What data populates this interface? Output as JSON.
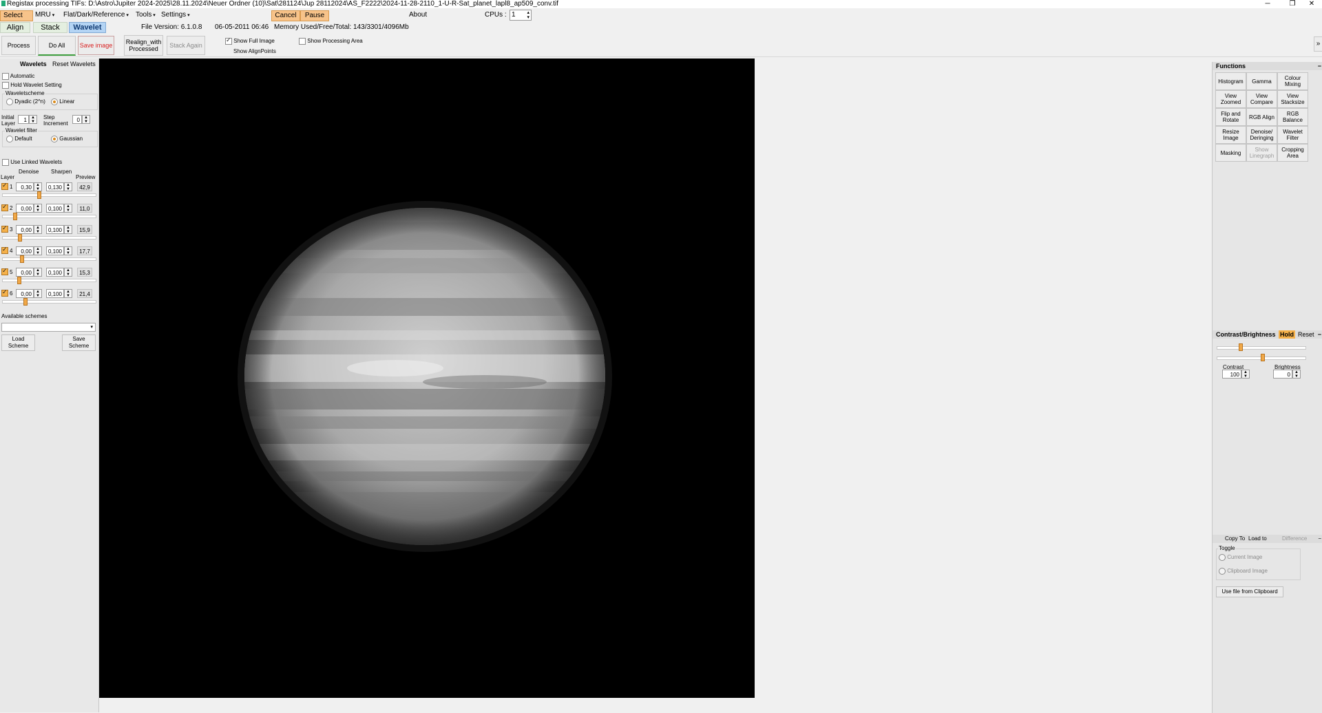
{
  "window": {
    "title": "Registax processing TIFs: D:\\Astro\\Jupiter 2024-2025\\28.11.2024\\Neuer Ordner (10)\\Sat\\281124\\Jup 28112024\\AS_F2222\\2024-11-28-2110_1-U-R-Sat_planet_lapl8_ap509_conv.tif",
    "minimize": "─",
    "maximize": "❐",
    "close": "✕"
  },
  "menu": {
    "select": "Select",
    "mru": "MRU",
    "flat": "Flat/Dark/Reference",
    "tools": "Tools",
    "settings": "Settings",
    "cancel": "Cancel",
    "pause": "Pause",
    "about": "About",
    "cpus_label": "CPUs :",
    "cpus_value": "1"
  },
  "tabs": {
    "align": "Align",
    "stack": "Stack",
    "wavelet": "Wavelet",
    "file_version": "File Version: 6.1.0.8",
    "date": "06-05-2011 06:46",
    "memory": "Memory Used/Free/Total: 143/3301/4096Mb"
  },
  "toolbar": {
    "process": "Process",
    "do_all": "Do All",
    "save_image": "Save image",
    "realign": "Realign_with Processed",
    "stack_again": "Stack Again",
    "show_full_image": "Show Full Image",
    "show_processing_area": "Show Processing Area",
    "show_alignpoints": "Show AlignPoints",
    "expand": "»"
  },
  "left": {
    "wavelets": "Wavelets",
    "reset_wavelets": "Reset Wavelets",
    "automatic": "Automatic",
    "hold_wavelet_setting": "Hold Wavelet Setting",
    "waveletscheme": "Waveletscheme",
    "dyadic": "Dyadic (2^n)",
    "linear": "Linear",
    "initial_layer_label": "Initial Layer",
    "initial_layer_value": "1",
    "step_increment_label": "Step Increment",
    "step_increment_value": "0",
    "wavelet_filter": "Wavelet filter",
    "default": "Default",
    "gaussian": "Gaussian",
    "use_linked_wavelets": "Use Linked Wavelets",
    "col_layer": "Layer",
    "col_denoise": "Denoise",
    "col_sharpen": "Sharpen",
    "col_preview": "Preview",
    "layers": [
      {
        "n": "1",
        "denoise": "0,30",
        "sharpen": "0,130",
        "preview": "42,9",
        "level": 0.38
      },
      {
        "n": "2",
        "denoise": "0,00",
        "sharpen": "0,100",
        "preview": "11,0",
        "level": 0.12
      },
      {
        "n": "3",
        "denoise": "0,00",
        "sharpen": "0,100",
        "preview": "15,9",
        "level": 0.17
      },
      {
        "n": "4",
        "denoise": "0,00",
        "sharpen": "0,100",
        "preview": "17,7",
        "level": 0.19
      },
      {
        "n": "5",
        "denoise": "0,00",
        "sharpen": "0,100",
        "preview": "15,3",
        "level": 0.16
      },
      {
        "n": "6",
        "denoise": "0,00",
        "sharpen": "0,100",
        "preview": "21,4",
        "level": 0.23
      }
    ],
    "available_schemes": "Available schemes",
    "load_scheme": "Load Scheme",
    "save_scheme": "Save Scheme"
  },
  "right": {
    "functions": "Functions",
    "buttons": [
      {
        "label": "Histogram",
        "enabled": true
      },
      {
        "label": "Gamma",
        "enabled": true
      },
      {
        "label": "Colour Mixing",
        "enabled": true
      },
      {
        "label": "View Zoomed",
        "enabled": true
      },
      {
        "label": "View Compare",
        "enabled": true
      },
      {
        "label": "View Stacksize",
        "enabled": true
      },
      {
        "label": "Flip and Rotate",
        "enabled": true
      },
      {
        "label": "RGB Align",
        "enabled": true
      },
      {
        "label": "RGB Balance",
        "enabled": true
      },
      {
        "label": "Resize Image",
        "enabled": true
      },
      {
        "label": "Denoise/ Deringing",
        "enabled": true
      },
      {
        "label": "Wavelet Filter",
        "enabled": true
      },
      {
        "label": "Masking",
        "enabled": true
      },
      {
        "label": "Show Linegraph",
        "enabled": false
      },
      {
        "label": "Cropping Area",
        "enabled": true
      }
    ],
    "contrast_brightness": "Contrast/Brightness",
    "hold": "Hold",
    "reset": "Reset",
    "contrast_label": "Contrast",
    "contrast_value": "100",
    "brightness_label": "Brightness",
    "brightness_value": "0",
    "copy_to": "Copy To",
    "load_to": "Load to",
    "difference": "Difference",
    "toggle": "Toggle",
    "current_image": "Current Image",
    "clipboard_image": "Clipboard Image",
    "use_file_from_clipboard": "Use file from Clipboard",
    "collapse": "−"
  },
  "colors": {
    "accent_orange": "#f7c38a",
    "tab_active": "#b4d4f4",
    "save_red": "#d82020"
  }
}
